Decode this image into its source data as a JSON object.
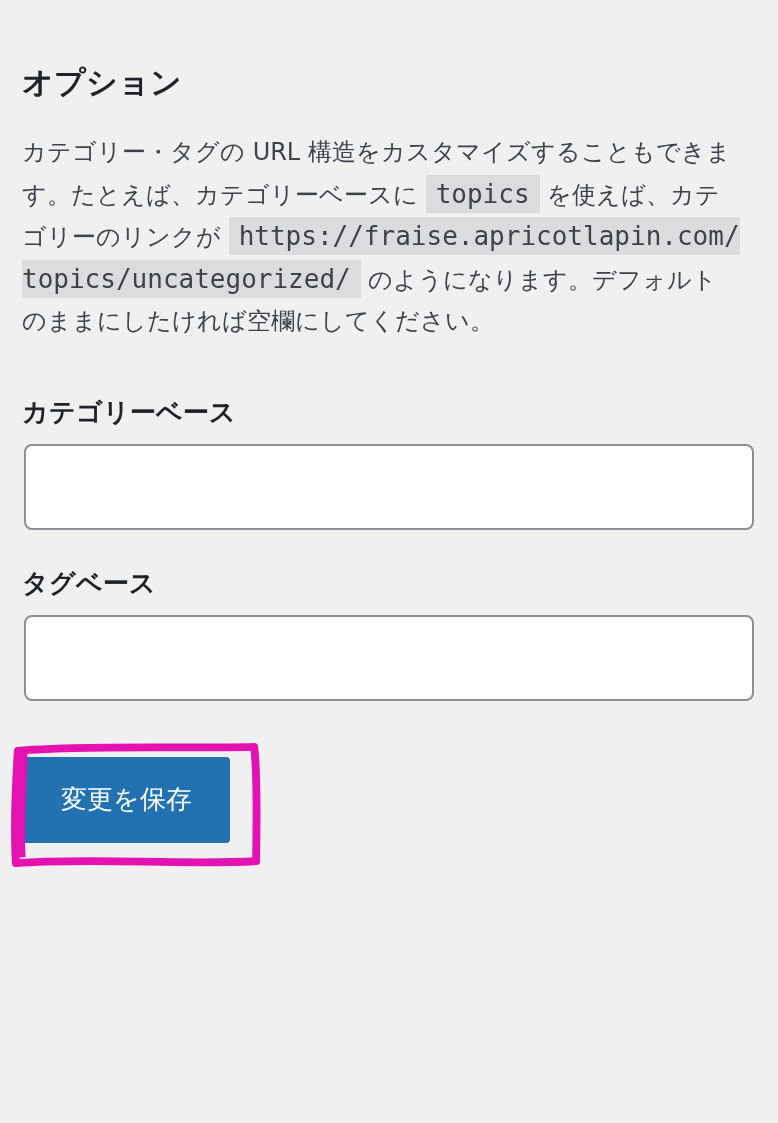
{
  "section": {
    "title": "オプション",
    "description": [
      {
        "kind": "text",
        "text": "カテゴリー・タグの URL 構造をカスタマイズすることもできます。たとえば、カテゴリーベースに "
      },
      {
        "kind": "code",
        "text": "topics"
      },
      {
        "kind": "text",
        "text": " を使えば、カテゴリーのリンクが "
      },
      {
        "kind": "code",
        "text": "https://fraise.apricotlapin.com/topics/uncategorized/"
      },
      {
        "kind": "text",
        "text": " のようになります。デフォルトのままにしたければ空欄にしてください。"
      }
    ]
  },
  "fields": [
    {
      "label": "カテゴリーベース"
    },
    {
      "label": "タグベース"
    }
  ],
  "save_button": {
    "label": "変更を保存",
    "highlighted": true
  }
}
